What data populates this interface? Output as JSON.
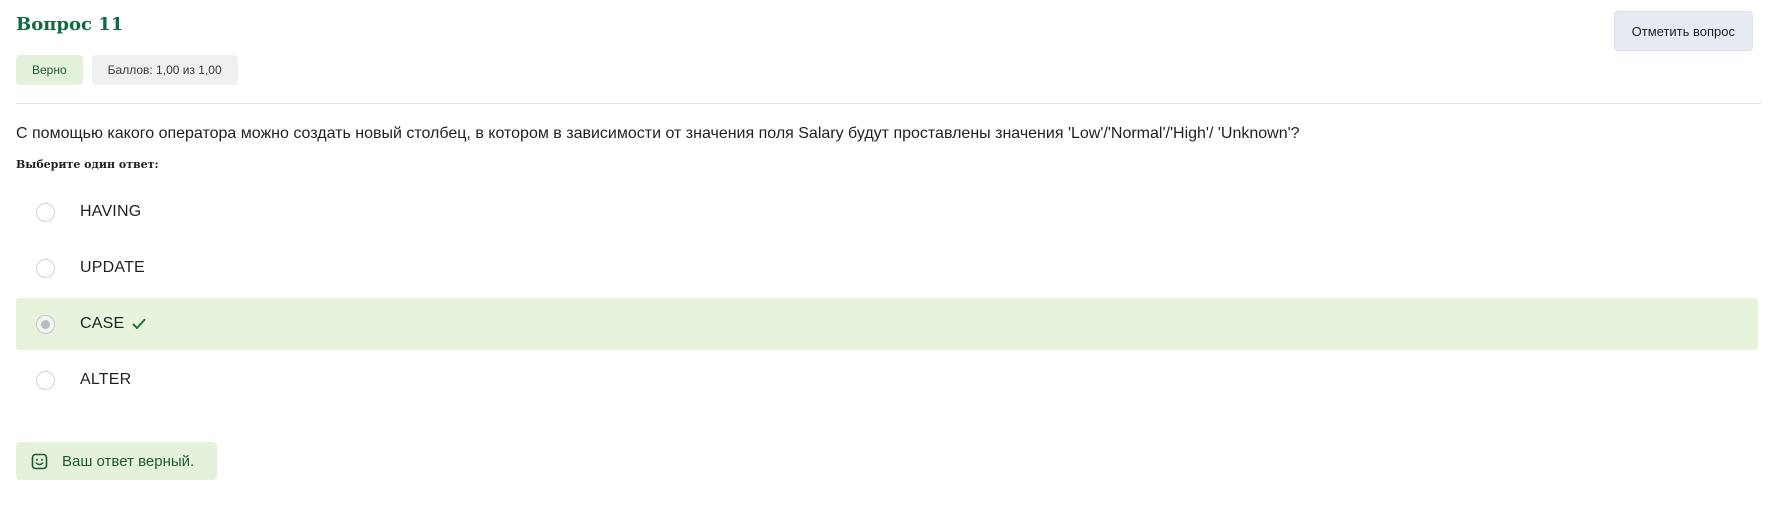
{
  "question": {
    "title": "Вопрос 11",
    "state": "Верно",
    "grade": "Баллов: 1,00 из 1,00",
    "flag_label": "Отметить вопрос",
    "text": "С помощью какого оператора можно создать новый столбец, в котором в зависимости от значения поля Salary будут проставлены значения 'Low'/'Normal'/'High'/ 'Unknown'?",
    "prompt": "Выберите один ответ:"
  },
  "answers": [
    {
      "label": "HAVING",
      "selected": false,
      "correct": false
    },
    {
      "label": "UPDATE",
      "selected": false,
      "correct": false
    },
    {
      "label": "CASE",
      "selected": true,
      "correct": true
    },
    {
      "label": "ALTER",
      "selected": false,
      "correct": false
    }
  ],
  "feedback": {
    "text": "Ваш ответ верный.",
    "icon": "smile-icon"
  },
  "colors": {
    "accent_green": "#0f6b3e",
    "correct_bg": "#e8f3dc",
    "flag_bg": "#e6eaf2"
  }
}
